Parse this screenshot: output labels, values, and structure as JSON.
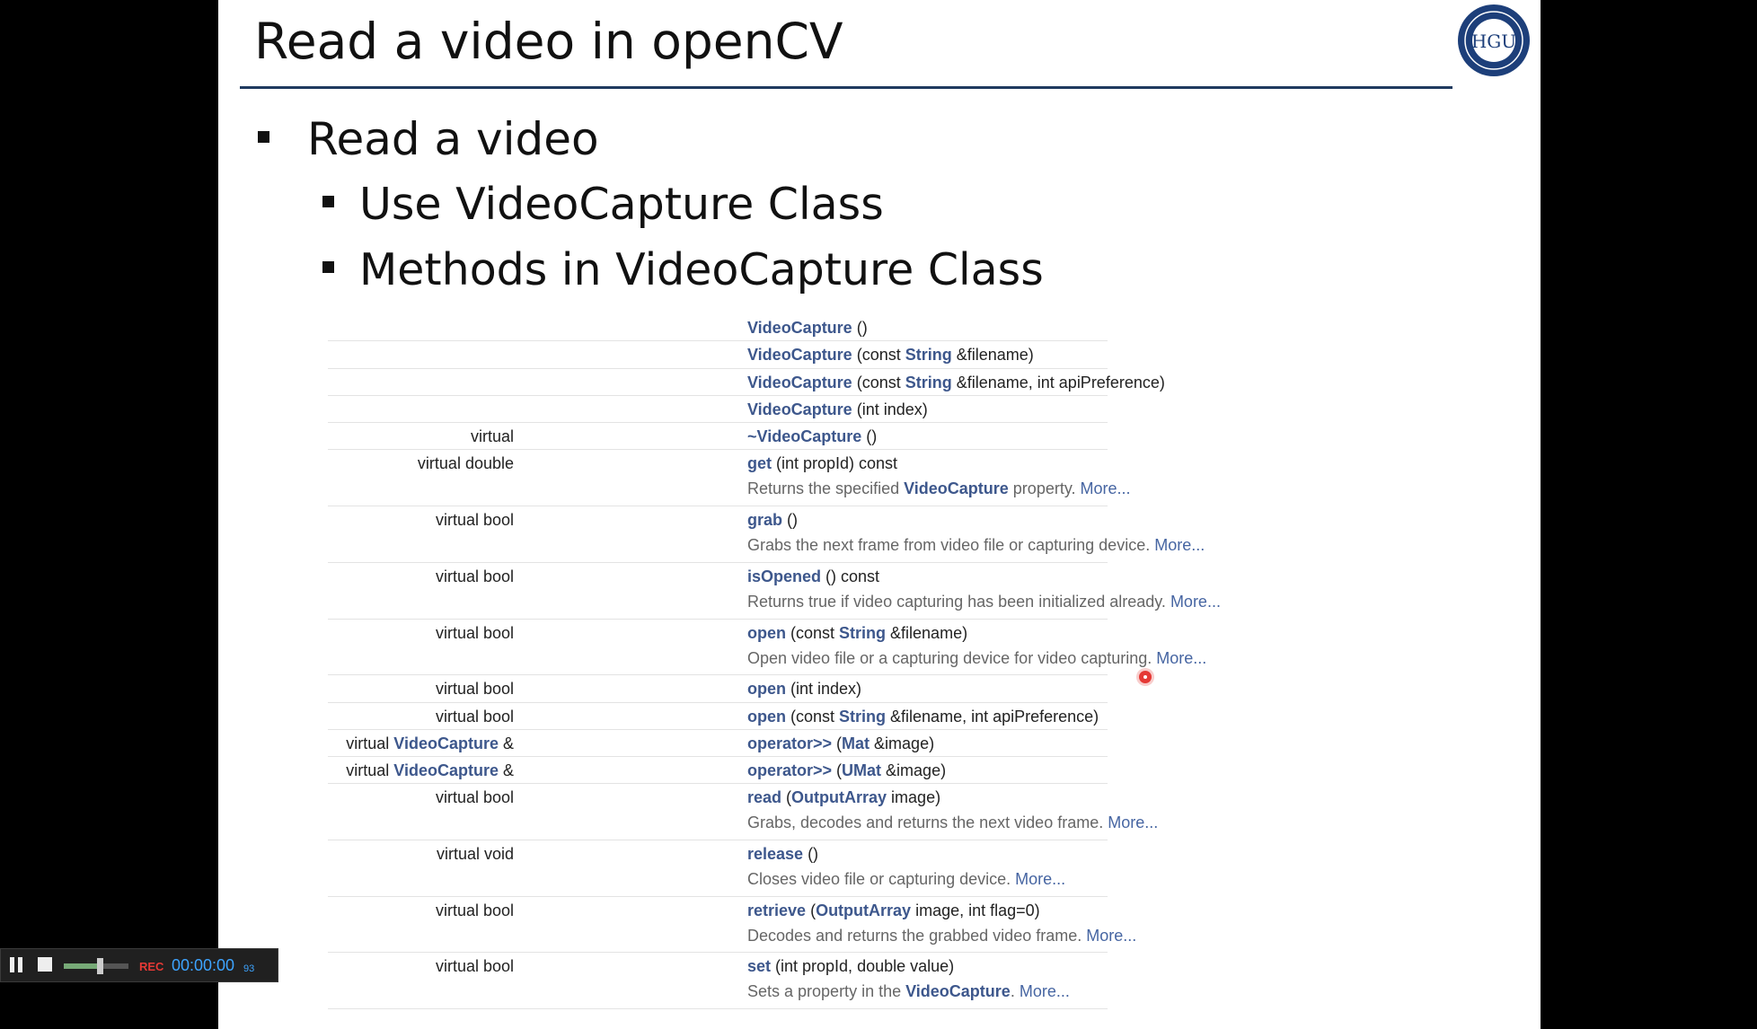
{
  "slide": {
    "title": "Read a video in openCV",
    "logo_text": "HGU",
    "bullets": {
      "level1": "Read a video",
      "level2": [
        "Use VideoCapture Class",
        "Methods in VideoCapture Class"
      ]
    }
  },
  "methods_table": [
    {
      "ret": "",
      "name": "VideoCapture",
      "sig": [
        {
          "t": " ()"
        }
      ],
      "desc": null
    },
    {
      "ret": "",
      "name": "VideoCapture",
      "sig": [
        {
          "t": " (const "
        },
        {
          "l": "String"
        },
        {
          "t": " &filename)"
        }
      ],
      "desc": null
    },
    {
      "ret": "",
      "name": "VideoCapture",
      "sig": [
        {
          "t": " (const "
        },
        {
          "l": "String"
        },
        {
          "t": " &filename, int apiPreference)"
        }
      ],
      "desc": null
    },
    {
      "ret": "",
      "name": "VideoCapture",
      "sig": [
        {
          "t": " (int index)"
        }
      ],
      "desc": null
    },
    {
      "ret": "virtual",
      "name": "~VideoCapture",
      "sig": [
        {
          "t": " ()"
        }
      ],
      "desc": null
    },
    {
      "ret": "virtual double",
      "name": "get",
      "sig": [
        {
          "t": " (int propId) const"
        }
      ],
      "desc": [
        {
          "t": "Returns the specified "
        },
        {
          "l": "VideoCapture"
        },
        {
          "t": " property. "
        },
        {
          "m": "More..."
        }
      ]
    },
    {
      "ret": "virtual bool",
      "name": "grab",
      "sig": [
        {
          "t": " ()"
        }
      ],
      "desc": [
        {
          "t": "Grabs the next frame from video file or capturing device. "
        },
        {
          "m": "More..."
        }
      ]
    },
    {
      "ret": "virtual bool",
      "name": "isOpened",
      "sig": [
        {
          "t": " () const"
        }
      ],
      "desc": [
        {
          "t": "Returns true if video capturing has been initialized already. "
        },
        {
          "m": "More..."
        }
      ]
    },
    {
      "ret": "virtual bool",
      "name": "open",
      "sig": [
        {
          "t": " (const "
        },
        {
          "l": "String"
        },
        {
          "t": " &filename)"
        }
      ],
      "desc": [
        {
          "t": "Open video file or a capturing device for video capturing. "
        },
        {
          "m": "More..."
        }
      ]
    },
    {
      "ret": "virtual bool",
      "name": "open",
      "sig": [
        {
          "t": " (int index)"
        }
      ],
      "desc": null
    },
    {
      "ret": "virtual bool",
      "name": "open",
      "sig": [
        {
          "t": " (const "
        },
        {
          "l": "String"
        },
        {
          "t": " &filename, int apiPreference)"
        }
      ],
      "desc": null
    },
    {
      "ret": "virtual |VideoCapture| &",
      "name": "operator>>",
      "sig": [
        {
          "t": " ("
        },
        {
          "l": "Mat"
        },
        {
          "t": " &image)"
        }
      ],
      "desc": null
    },
    {
      "ret": "virtual |VideoCapture| &",
      "name": "operator>>",
      "sig": [
        {
          "t": " ("
        },
        {
          "l": "UMat"
        },
        {
          "t": " &image)"
        }
      ],
      "desc": null
    },
    {
      "ret": "virtual bool",
      "name": "read",
      "sig": [
        {
          "t": " ("
        },
        {
          "l": "OutputArray"
        },
        {
          "t": " image)"
        }
      ],
      "desc": [
        {
          "t": "Grabs, decodes and returns the next video frame. "
        },
        {
          "m": "More..."
        }
      ]
    },
    {
      "ret": "virtual void",
      "name": "release",
      "sig": [
        {
          "t": " ()"
        }
      ],
      "desc": [
        {
          "t": "Closes video file or capturing device. "
        },
        {
          "m": "More..."
        }
      ]
    },
    {
      "ret": "virtual bool",
      "name": "retrieve",
      "sig": [
        {
          "t": " ("
        },
        {
          "l": "OutputArray"
        },
        {
          "t": " image, int flag=0)"
        }
      ],
      "desc": [
        {
          "t": "Decodes and returns the grabbed video frame. "
        },
        {
          "m": "More..."
        }
      ]
    },
    {
      "ret": "virtual bool",
      "name": "set",
      "sig": [
        {
          "t": " (int propId, double value)"
        }
      ],
      "desc": [
        {
          "t": "Sets a property in the "
        },
        {
          "l": "VideoCapture"
        },
        {
          "t": ". "
        },
        {
          "m": "More..."
        }
      ]
    }
  ],
  "player": {
    "rec_label": "REC",
    "time": "00:00:00",
    "ms": "93",
    "volume_level": 0.55,
    "colors": {
      "time": "#3da4ff",
      "rec": "#e53935"
    }
  }
}
